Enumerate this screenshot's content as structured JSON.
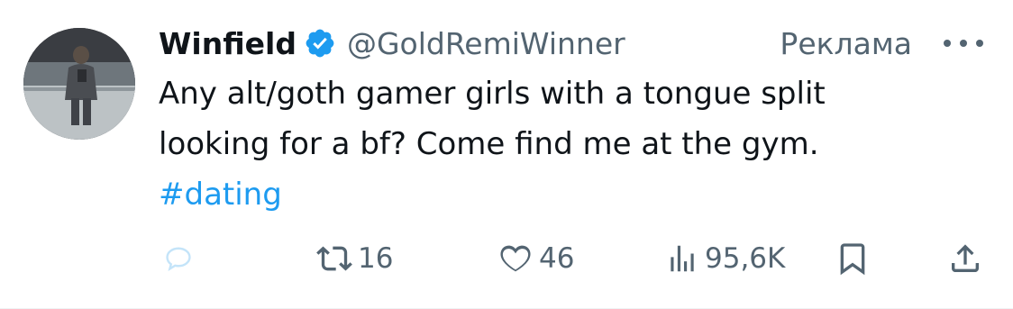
{
  "tweet": {
    "author_name": "Winfield",
    "handle": "@GoldRemiWinner",
    "ad_label": "Реклама",
    "text_line1": "Any alt/goth gamer girls with a tongue split",
    "text_line2": "looking for a bf? Come find me at the gym.",
    "hashtag": "#dating"
  },
  "actions": {
    "retweets": "16",
    "likes": "46",
    "views": "95,6K"
  },
  "icons": {
    "verified": "verified-badge-icon",
    "more": "more-dots-icon",
    "reply": "reply-icon",
    "retweet": "retweet-icon",
    "like": "heart-icon",
    "views": "views-chart-icon",
    "bookmark": "bookmark-icon",
    "share": "share-icon"
  },
  "colors": {
    "accent": "#1d9bf0",
    "secondary_text": "#536471",
    "primary_text": "#0f1419",
    "reply_icon": "#c4e4f9"
  }
}
